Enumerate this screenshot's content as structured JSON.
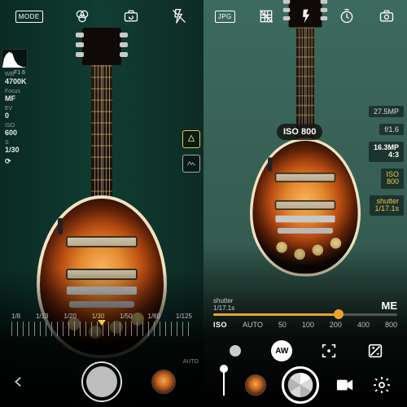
{
  "left": {
    "top": {
      "mode_label": "MODE"
    },
    "histogram_label": "F1.6",
    "readouts": {
      "wb": {
        "tag": "WB",
        "value": "4700K"
      },
      "focus": {
        "tag": "Focus",
        "value": "MF"
      },
      "ev": {
        "tag": "EV",
        "value": "0"
      },
      "iso": {
        "tag": "ISO",
        "value": "600"
      },
      "shutter": {
        "tag": "S",
        "value": "1/30"
      },
      "last": {
        "tag": "",
        "value": "⟳"
      }
    },
    "ruler": {
      "stops": [
        "1/8",
        "1/13",
        "1/20",
        "1/30",
        "1/50",
        "1/80",
        "1/125"
      ],
      "selected_index": 3
    },
    "auto_tag": "AUTO"
  },
  "right": {
    "top": {
      "fmt": "JPG",
      "flash": "⚡"
    },
    "side": {
      "mp": "27.5MP",
      "aperture": "f/1.6",
      "res": {
        "mp": "16.3MP",
        "ratio": "4:3"
      },
      "iso": {
        "tag": "ISO",
        "value": "800"
      },
      "shutter": {
        "tag": "shutter",
        "value": "1/17.1s"
      }
    },
    "iso_tooltip": "ISO 800",
    "slider": {
      "left_label_top": "shutter",
      "left_label_bottom": "1/17.1s",
      "right_label": "ME",
      "value_pct": 68
    },
    "iso_row": {
      "head": "ISO",
      "stops": [
        "AUTO",
        "50",
        "100",
        "200",
        "400",
        "800"
      ]
    },
    "fx": {
      "aw": "AW"
    }
  }
}
